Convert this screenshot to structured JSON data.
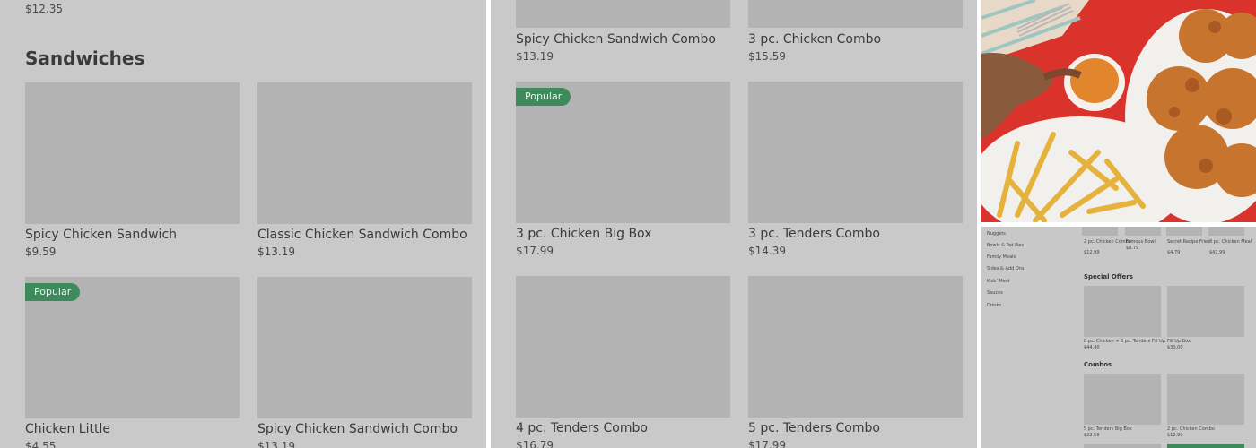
{
  "panel1": {
    "top_price": "$12.35",
    "section_title": "Sandwiches",
    "items": [
      {
        "title": "Spicy Chicken Sandwich",
        "price": "$9.59"
      },
      {
        "title": "Classic Chicken Sandwich Combo",
        "price": "$13.19"
      },
      {
        "title": "Chicken Little",
        "price": "$4.55",
        "badge": "Popular"
      },
      {
        "title": "Spicy Chicken Sandwich Combo",
        "price": "$13.19"
      }
    ]
  },
  "panel2": {
    "items": [
      {
        "title": "Spicy Chicken Sandwich Combo",
        "price": "$13.19"
      },
      {
        "title": "3 pc. Chicken Combo",
        "price": "$15.59"
      },
      {
        "title": "3 pc. Chicken Big Box",
        "price": "$17.99",
        "badge": "Popular"
      },
      {
        "title": "3 pc. Tenders Combo",
        "price": "$14.39"
      },
      {
        "title": "4 pc. Tenders Combo",
        "price": "$16.79"
      },
      {
        "title": "5 pc. Tenders Combo",
        "price": "$17.99"
      }
    ]
  },
  "panel3": {
    "sidebar": [
      "Nuggets",
      "Bowls & Pot Pies",
      "Family Meals",
      "Sides & Add Ons",
      "Kids' Meal",
      "Sauces",
      "Drinks"
    ],
    "top_row": [
      {
        "title": "2 pc. Chicken Combo",
        "price": "$12.99"
      },
      {
        "title": "Famous Bowl",
        "price": "$8.79"
      },
      {
        "title": "Secret Recipe Fries",
        "price": "$4.79"
      },
      {
        "title": "8 pc. Chicken Meal",
        "price": "$41.99"
      }
    ],
    "special_offers_title": "Special Offers",
    "special_offers": [
      {
        "title": "8 pc. Chicken + 8 pc. Tenders Fill Up",
        "price": "$44.40"
      },
      {
        "title": "Fill Up Box",
        "price": "$30.00"
      }
    ],
    "combos_title": "Combos",
    "combos": [
      {
        "title": "5 pc. Tenders Big Box",
        "price": "$22.59"
      },
      {
        "title": "2 pc. Chicken Combo",
        "price": "$12.99"
      }
    ]
  },
  "colors": {
    "overlay": "#c9c9c9",
    "placeholder": "#b3b3b3",
    "badge_green": "#3f8a5c",
    "photo_red": "#d9332c"
  }
}
